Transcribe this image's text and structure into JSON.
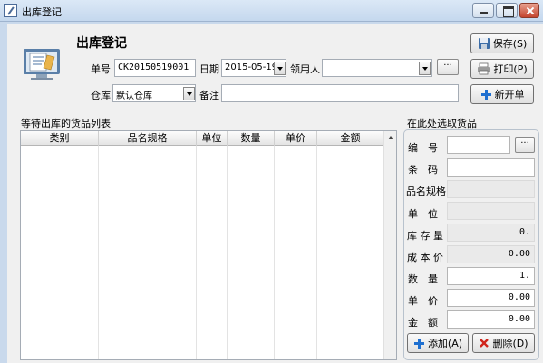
{
  "window": {
    "title": "出库登记"
  },
  "form": {
    "heading": "出库登记",
    "order_no_label": "单号",
    "order_no": "CK20150519001",
    "date_label": "日期",
    "date": "2015-05-19",
    "receiver_label": "领用人",
    "receiver": "",
    "ellipsis": "···",
    "warehouse_label": "仓库",
    "warehouse": "默认仓库",
    "remark_label": "备注",
    "remark": ""
  },
  "toolbar": {
    "save_label": "保存(S)",
    "print_label": "打印(P)",
    "new_label": "新开单"
  },
  "list": {
    "title": "等待出库的货品列表",
    "columns": [
      "类别",
      "品名规格",
      "单位",
      "数量",
      "单价",
      "金额"
    ]
  },
  "picker": {
    "title": "在此处选取货品",
    "ellipsis": "···",
    "code_label": "编　号",
    "code": "",
    "barcode_label": "条　码",
    "barcode": "",
    "name_label": "品名规格",
    "name": "",
    "unit_label": "单　位",
    "unit": "",
    "stock_label": "库 存 量",
    "stock": "0.",
    "cost_label": "成 本 价",
    "cost": "0.00",
    "qty_label": "数　量",
    "qty": "1.",
    "price_label": "单　价",
    "price": "0.00",
    "amount_label": "金　额",
    "amount": "0.00",
    "add_label": "添加(A)",
    "delete_label": "删除(D)"
  },
  "colors": {
    "titlebar": "#c5d8ee",
    "window_bg": "#f0f0f0",
    "accent_blue": "#1e6fd0",
    "delete_red": "#d0241b"
  }
}
